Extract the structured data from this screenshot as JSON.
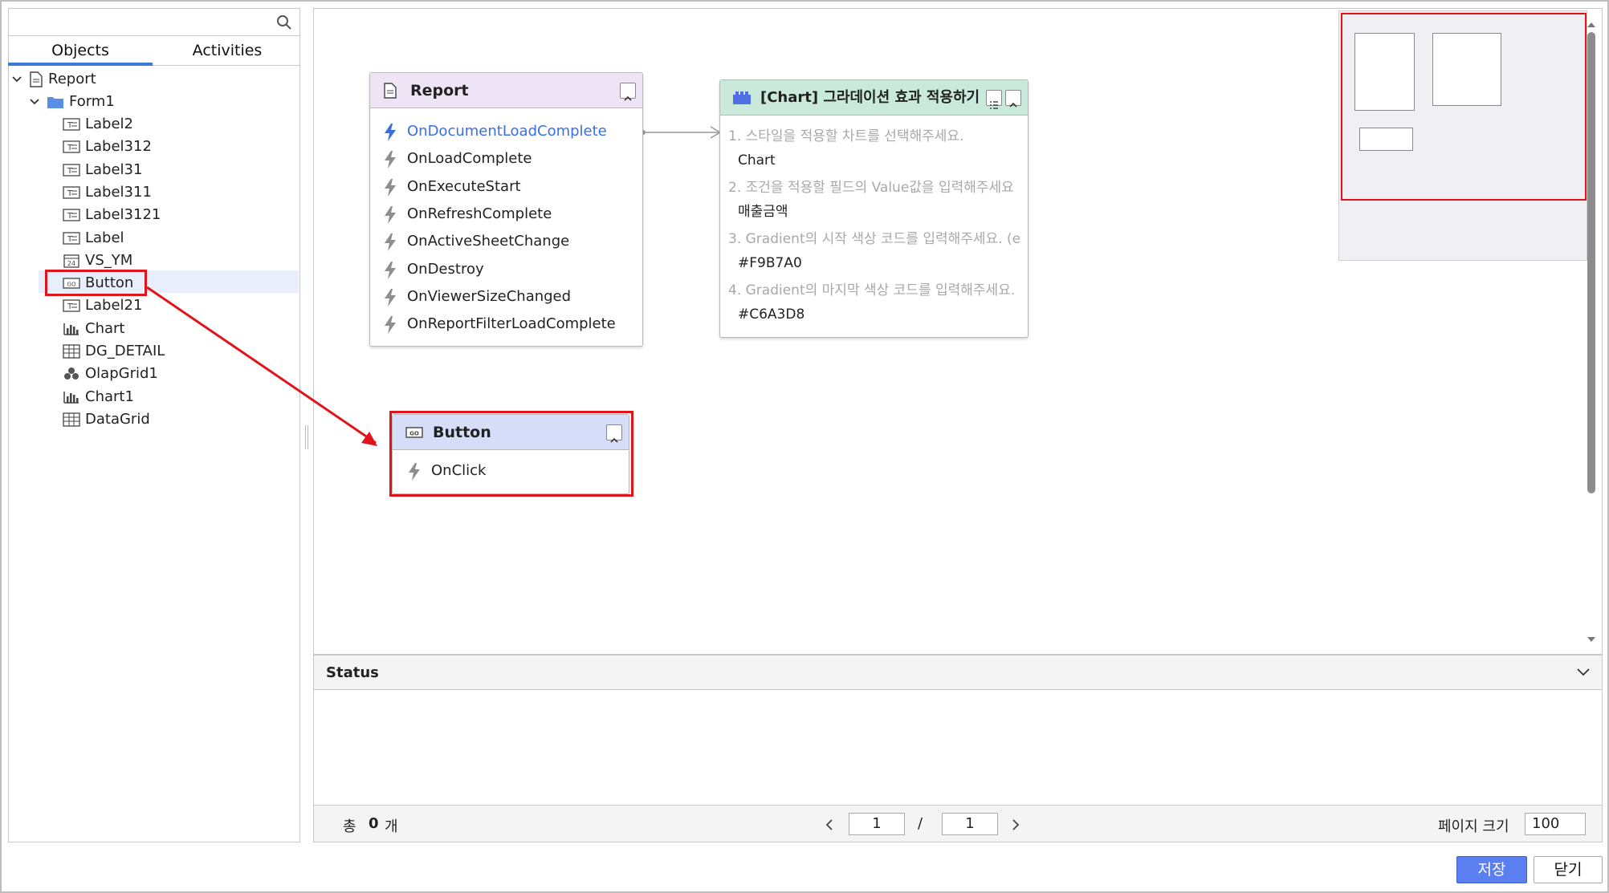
{
  "search": {
    "placeholder": ""
  },
  "tabs": [
    {
      "label": "Objects"
    },
    {
      "label": "Activities"
    }
  ],
  "tree": {
    "root": "Report",
    "form": "Form1",
    "items": [
      {
        "label": "Label2",
        "icon": "label-icon"
      },
      {
        "label": "Label312",
        "icon": "label-icon"
      },
      {
        "label": "Label31",
        "icon": "label-icon"
      },
      {
        "label": "Label311",
        "icon": "label-icon"
      },
      {
        "label": "Label3121",
        "icon": "label-icon"
      },
      {
        "label": "Label",
        "icon": "label-icon"
      },
      {
        "label": "VS_YM",
        "icon": "calendar-icon"
      },
      {
        "label": "Button",
        "icon": "button-icon"
      },
      {
        "label": "Label21",
        "icon": "label-icon"
      },
      {
        "label": "Chart",
        "icon": "chart-icon"
      },
      {
        "label": "DG_DETAIL",
        "icon": "grid-icon"
      },
      {
        "label": "OlapGrid1",
        "icon": "olap-icon"
      },
      {
        "label": "Chart1",
        "icon": "chart-icon"
      },
      {
        "label": "DataGrid",
        "icon": "grid-icon"
      }
    ]
  },
  "report_card": {
    "title": "Report",
    "events": [
      "OnDocumentLoadComplete",
      "OnLoadComplete",
      "OnExecuteStart",
      "OnRefreshComplete",
      "OnActiveSheetChange",
      "OnDestroy",
      "OnViewerSizeChanged",
      "OnReportFilterLoadComplete"
    ]
  },
  "chart_card": {
    "title": "[Chart] 그라데이션 효과 적용하기",
    "params": [
      {
        "prompt": "1. 스타일을 적용할 차트를 선택해주세요.",
        "value": "Chart"
      },
      {
        "prompt": "2. 조건을 적용할 필드의 Value값을 입력해주세요",
        "value": "매출금액"
      },
      {
        "prompt": "3. Gradient의 시작 색상 코드를 입력해주세요. (e",
        "value": "#F9B7A0"
      },
      {
        "prompt": "4. Gradient의 마지막 색상 코드를 입력해주세요.",
        "value": "#C6A3D8"
      }
    ]
  },
  "button_card": {
    "title": "Button",
    "events": [
      "OnClick"
    ]
  },
  "status": {
    "title": "Status",
    "total_prefix": "총",
    "total_count": "0",
    "total_suffix": "개",
    "page_current": "1",
    "page_sep": "/",
    "page_total": "1",
    "page_size_label": "페이지 크기",
    "page_size": "100"
  },
  "footer": {
    "save_label": "저장",
    "close_label": "닫기"
  },
  "colors": {
    "accent": "#5b7ff0",
    "highlight": "#e0141b",
    "event_active": "#3a6fe0",
    "chart_header": "#c9eadb",
    "report_header": "#efe4f6",
    "button_header": "#d5ddf8"
  }
}
